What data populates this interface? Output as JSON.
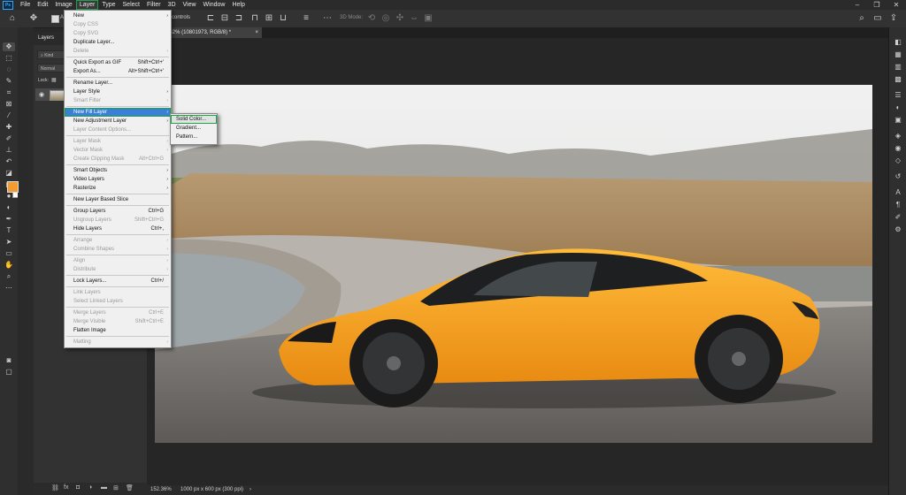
{
  "menubar": {
    "logo": "Ps",
    "items": [
      "File",
      "Edit",
      "Image",
      "Layer",
      "Type",
      "Select",
      "Filter",
      "3D",
      "View",
      "Window",
      "Help"
    ],
    "active_index": 3
  },
  "window_controls": [
    "–",
    "❐",
    "✕"
  ],
  "optionsbar": {
    "auto_select_label": "Au",
    "show_controls_label": "controls",
    "mode_3d_label": "3D Mode:"
  },
  "document_tab": {
    "title": "3-2 @ 152% (10801973, RGB/8) *",
    "close": "×"
  },
  "layers_panel": {
    "title": "Layers",
    "kind_label": "Kind",
    "blend_mode": "Normal",
    "lock_label": "Lock:"
  },
  "statusbar": {
    "zoom": "152.36%",
    "doc_size": "1000 px x 600 px (300 ppi)",
    "arrow": "›"
  },
  "layer_menu": {
    "items": [
      {
        "label": "New",
        "arrow": "›",
        "disabled": false
      },
      {
        "label": "Copy CSS",
        "disabled": true
      },
      {
        "label": "Copy SVG",
        "disabled": true
      },
      {
        "label": "Duplicate Layer...",
        "disabled": false
      },
      {
        "label": "Delete",
        "arrow": "›",
        "disabled": true
      },
      {
        "sep": true
      },
      {
        "label": "Quick Export as GIF",
        "shortcut": "Shift+Ctrl+'",
        "disabled": false
      },
      {
        "label": "Export As...",
        "shortcut": "Alt+Shift+Ctrl+'",
        "disabled": false
      },
      {
        "sep": true
      },
      {
        "label": "Rename Layer...",
        "disabled": false
      },
      {
        "label": "Layer Style",
        "arrow": "›",
        "disabled": false
      },
      {
        "label": "Smart Filter",
        "arrow": "›",
        "disabled": true
      },
      {
        "sep": true
      },
      {
        "label": "New Fill Layer",
        "arrow": "›",
        "disabled": false,
        "highlight": true
      },
      {
        "label": "New Adjustment Layer",
        "arrow": "›",
        "disabled": false
      },
      {
        "label": "Layer Content Options...",
        "disabled": true
      },
      {
        "sep": true
      },
      {
        "label": "Layer Mask",
        "arrow": "›",
        "disabled": true
      },
      {
        "label": "Vector Mask",
        "arrow": "›",
        "disabled": true
      },
      {
        "label": "Create Clipping Mask",
        "shortcut": "Alt+Ctrl+G",
        "disabled": true
      },
      {
        "sep": true
      },
      {
        "label": "Smart Objects",
        "arrow": "›",
        "disabled": false
      },
      {
        "label": "Video Layers",
        "arrow": "›",
        "disabled": false
      },
      {
        "label": "Rasterize",
        "arrow": "›",
        "disabled": false
      },
      {
        "sep": true
      },
      {
        "label": "New Layer Based Slice",
        "disabled": false
      },
      {
        "sep": true
      },
      {
        "label": "Group Layers",
        "shortcut": "Ctrl+G",
        "disabled": false
      },
      {
        "label": "Ungroup Layers",
        "shortcut": "Shift+Ctrl+G",
        "disabled": true
      },
      {
        "label": "Hide Layers",
        "shortcut": "Ctrl+,",
        "disabled": false
      },
      {
        "sep": true
      },
      {
        "label": "Arrange",
        "arrow": "›",
        "disabled": true
      },
      {
        "label": "Combine Shapes",
        "arrow": "›",
        "disabled": true
      },
      {
        "sep": true
      },
      {
        "label": "Align",
        "arrow": "›",
        "disabled": true
      },
      {
        "label": "Distribute",
        "arrow": "›",
        "disabled": true
      },
      {
        "sep": true
      },
      {
        "label": "Lock Layers...",
        "shortcut": "Ctrl+/",
        "disabled": false
      },
      {
        "sep": true
      },
      {
        "label": "Link Layers",
        "disabled": true
      },
      {
        "label": "Select Linked Layers",
        "disabled": true
      },
      {
        "sep": true
      },
      {
        "label": "Merge Layers",
        "shortcut": "Ctrl+E",
        "disabled": true
      },
      {
        "label": "Merge Visible",
        "shortcut": "Shift+Ctrl+E",
        "disabled": true
      },
      {
        "label": "Flatten Image",
        "disabled": false
      },
      {
        "sep": true
      },
      {
        "label": "Matting",
        "arrow": "›",
        "disabled": true
      }
    ]
  },
  "fill_submenu": {
    "items": [
      {
        "label": "Solid Color...",
        "highlight": true
      },
      {
        "label": "Gradient..."
      },
      {
        "label": "Pattern..."
      }
    ]
  },
  "colors": {
    "foreground": "#f29b30",
    "background": "#ffffff",
    "menu_highlight": "#3c7fd6",
    "annotation_green": "#1aa34a"
  }
}
